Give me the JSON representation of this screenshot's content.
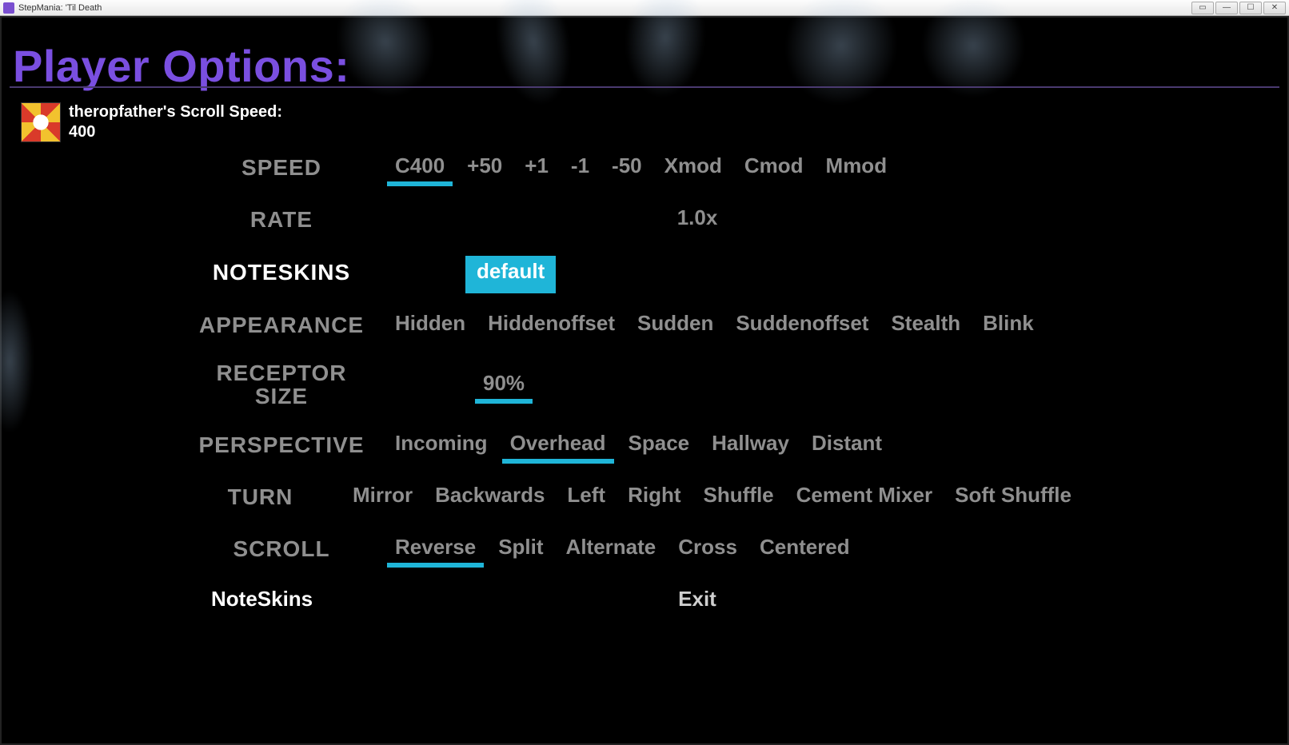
{
  "window": {
    "title": "StepMania: 'Til Death"
  },
  "header": {
    "title": "Player Options:"
  },
  "player": {
    "label": "theropfather's Scroll Speed:",
    "value": "400"
  },
  "rows": {
    "speed": {
      "label": "SPEED",
      "options": [
        "C400",
        "+50",
        "+1",
        "-1",
        "-50",
        "Xmod",
        "Cmod",
        "Mmod"
      ],
      "selected": "C400"
    },
    "rate": {
      "label": "RATE",
      "options": [
        "1.0x"
      ],
      "selected": "1.0x"
    },
    "noteskins": {
      "label": "NOTESKINS",
      "options": [
        "default"
      ],
      "selected": "default"
    },
    "appearance": {
      "label": "APPEARANCE",
      "options": [
        "Hidden",
        "Hiddenoffset",
        "Sudden",
        "Suddenoffset",
        "Stealth",
        "Blink"
      ]
    },
    "receptor_size": {
      "label": "RECEPTOR SIZE",
      "options": [
        "90%"
      ],
      "selected": "90%"
    },
    "perspective": {
      "label": "PERSPECTIVE",
      "options": [
        "Incoming",
        "Overhead",
        "Space",
        "Hallway",
        "Distant"
      ],
      "selected": "Overhead"
    },
    "turn": {
      "label": "TURN",
      "options": [
        "Mirror",
        "Backwards",
        "Left",
        "Right",
        "Shuffle",
        "Cement Mixer",
        "Soft Shuffle"
      ]
    },
    "scroll": {
      "label": "SCROLL",
      "options": [
        "Reverse",
        "Split",
        "Alternate",
        "Cross",
        "Centered"
      ],
      "selected": "Reverse"
    },
    "exit": {
      "label": "Exit"
    }
  },
  "footer": {
    "description": "NoteSkins"
  }
}
